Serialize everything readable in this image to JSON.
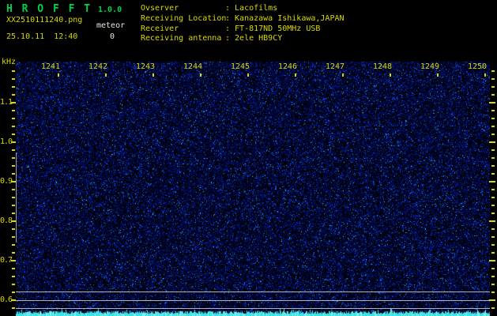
{
  "header": {
    "app_title": "H R O F F T",
    "app_version": "1.0.0",
    "filename": "XX2510111240.png",
    "datetime": "25.10.11  12:40",
    "counter_label": "meteor",
    "counter_value": "0",
    "colon": ": ",
    "info_rows": [
      {
        "label": "Ovserver",
        "value": "Lacofilms"
      },
      {
        "label": "Receiving Location",
        "value": "Kanazawa Ishikawa,JAPAN"
      },
      {
        "label": "Receiver",
        "value": "FT-817ND 50MHz USB"
      },
      {
        "label": "Receiving antenna",
        "value": "2ele HB9CY"
      }
    ]
  },
  "chart_data": {
    "type": "heatmap",
    "subtype": "radio-meteor-spectrogram",
    "title": "HROFFT 1.0.0 meteor echo spectrogram, 25.10.11 12:40",
    "x_axis": {
      "unit": "time (HHMM, 1-minute steps)",
      "tick_labels": [
        "1241",
        "1242",
        "1243",
        "1244",
        "1245",
        "1246",
        "1247",
        "1248",
        "1249",
        "1250"
      ]
    },
    "y_axis": {
      "unit": "kHz",
      "tick_labels": [
        "1.1",
        "1.0",
        "0.9",
        "0.8",
        "0.7",
        "0.6"
      ],
      "top_khz": 1.17,
      "bottom_khz": 0.56,
      "minor_step_khz": 0.02
    },
    "meteor_count": 0,
    "reference_lines_khz": [
      0.622,
      0.6,
      0.58
    ],
    "content_description": "Uniform dark-blue background radio noise with sparse brighter speckles; no meteor echo traces visible; jagged cyan noise-floor level trace along the bottom edge; short gray vertical marker segment at left edge between ~0.79 and ~1.03 kHz.",
    "legend": null,
    "grid": false
  },
  "colors": {
    "background": "#000000",
    "title_green": "#00d24a",
    "axis_yellow": "#d9d900",
    "text_white": "#e9e9dc",
    "noise_blue_dim": "#000080",
    "noise_blue_bright": "#3355ff",
    "signal_cyan": "#3ce3e3",
    "ref_line_gray": "#b4b4b4"
  }
}
